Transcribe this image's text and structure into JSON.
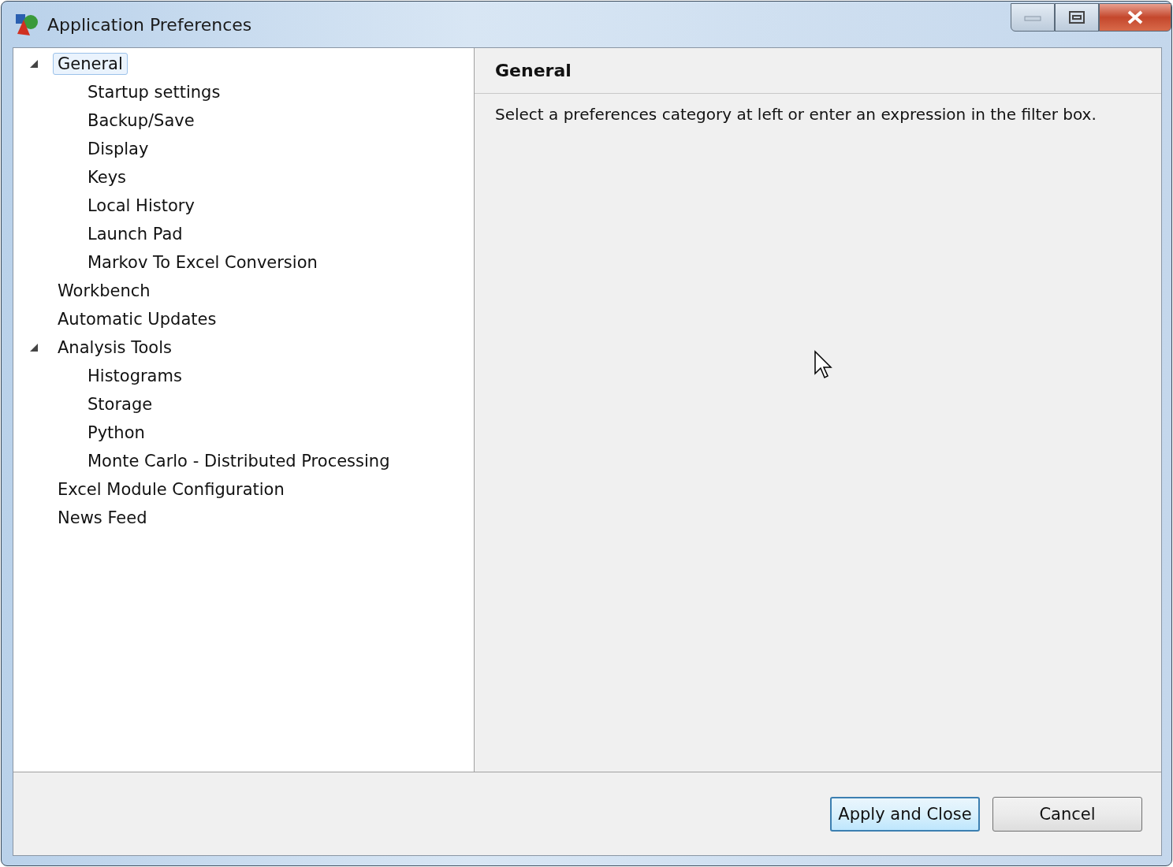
{
  "window": {
    "title": "Application Preferences"
  },
  "tree": [
    {
      "label": "General",
      "selected": true,
      "expanded": true,
      "children": [
        {
          "label": "Startup settings",
          "selected": false
        },
        {
          "label": "Backup/Save",
          "selected": false
        },
        {
          "label": "Display",
          "selected": false
        },
        {
          "label": "Keys",
          "selected": false
        },
        {
          "label": "Local History",
          "selected": false
        },
        {
          "label": "Launch Pad",
          "selected": false
        },
        {
          "label": "Markov To Excel Conversion",
          "selected": false
        }
      ]
    },
    {
      "label": "Workbench",
      "selected": false
    },
    {
      "label": "Automatic Updates",
      "selected": false
    },
    {
      "label": "Analysis Tools",
      "selected": false,
      "expanded": true,
      "children": [
        {
          "label": "Histograms",
          "selected": false
        },
        {
          "label": "Storage",
          "selected": false
        },
        {
          "label": "Python",
          "selected": false
        },
        {
          "label": "Monte Carlo - Distributed Processing",
          "selected": false
        }
      ]
    },
    {
      "label": "Excel Module Configuration",
      "selected": false
    },
    {
      "label": "News Feed",
      "selected": false
    }
  ],
  "page": {
    "title": "General",
    "text": "Select a preferences category at left or enter an expression in the filter box."
  },
  "buttons": [
    {
      "label": "Apply and Close",
      "default": true
    },
    {
      "label": "Cancel",
      "default": false
    }
  ]
}
